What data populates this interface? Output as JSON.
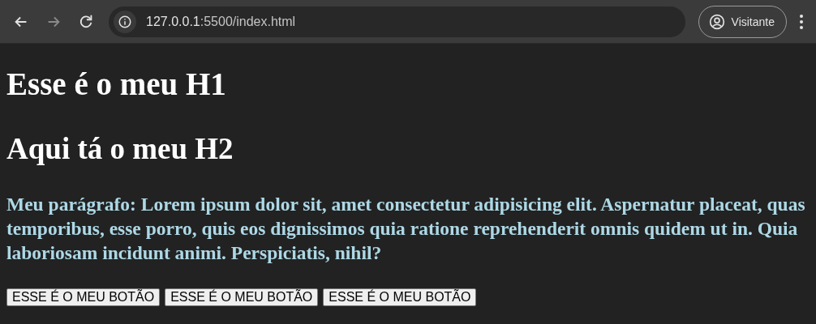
{
  "toolbar": {
    "nav": [
      {
        "kind": "back",
        "disabled": false
      },
      {
        "kind": "forward",
        "disabled": true
      },
      {
        "kind": "reload",
        "disabled": false
      }
    ],
    "address": {
      "host": "127.0.0.1",
      "path": ":5500/index.html"
    },
    "profile": {
      "label": "Visitante"
    }
  },
  "page": {
    "h1": "Esse é o meu H1",
    "h2": "Aqui tá o meu H2",
    "paragraph": "Meu parágrafo: Lorem ipsum dolor sit, amet consectetur adipisicing elit. Aspernatur placeat, quas temporibus, esse porro, quis eos dignissimos quia ratione reprehenderit omnis quidem ut in. Quia laboriosam incidunt animi. Perspiciatis, nihil?",
    "buttons": [
      {
        "label": "ESSE É O MEU BOTÃO"
      },
      {
        "label": "ESSE É O MEU BOTÃO"
      },
      {
        "label": "ESSE É O MEU BOTÃO"
      }
    ]
  }
}
